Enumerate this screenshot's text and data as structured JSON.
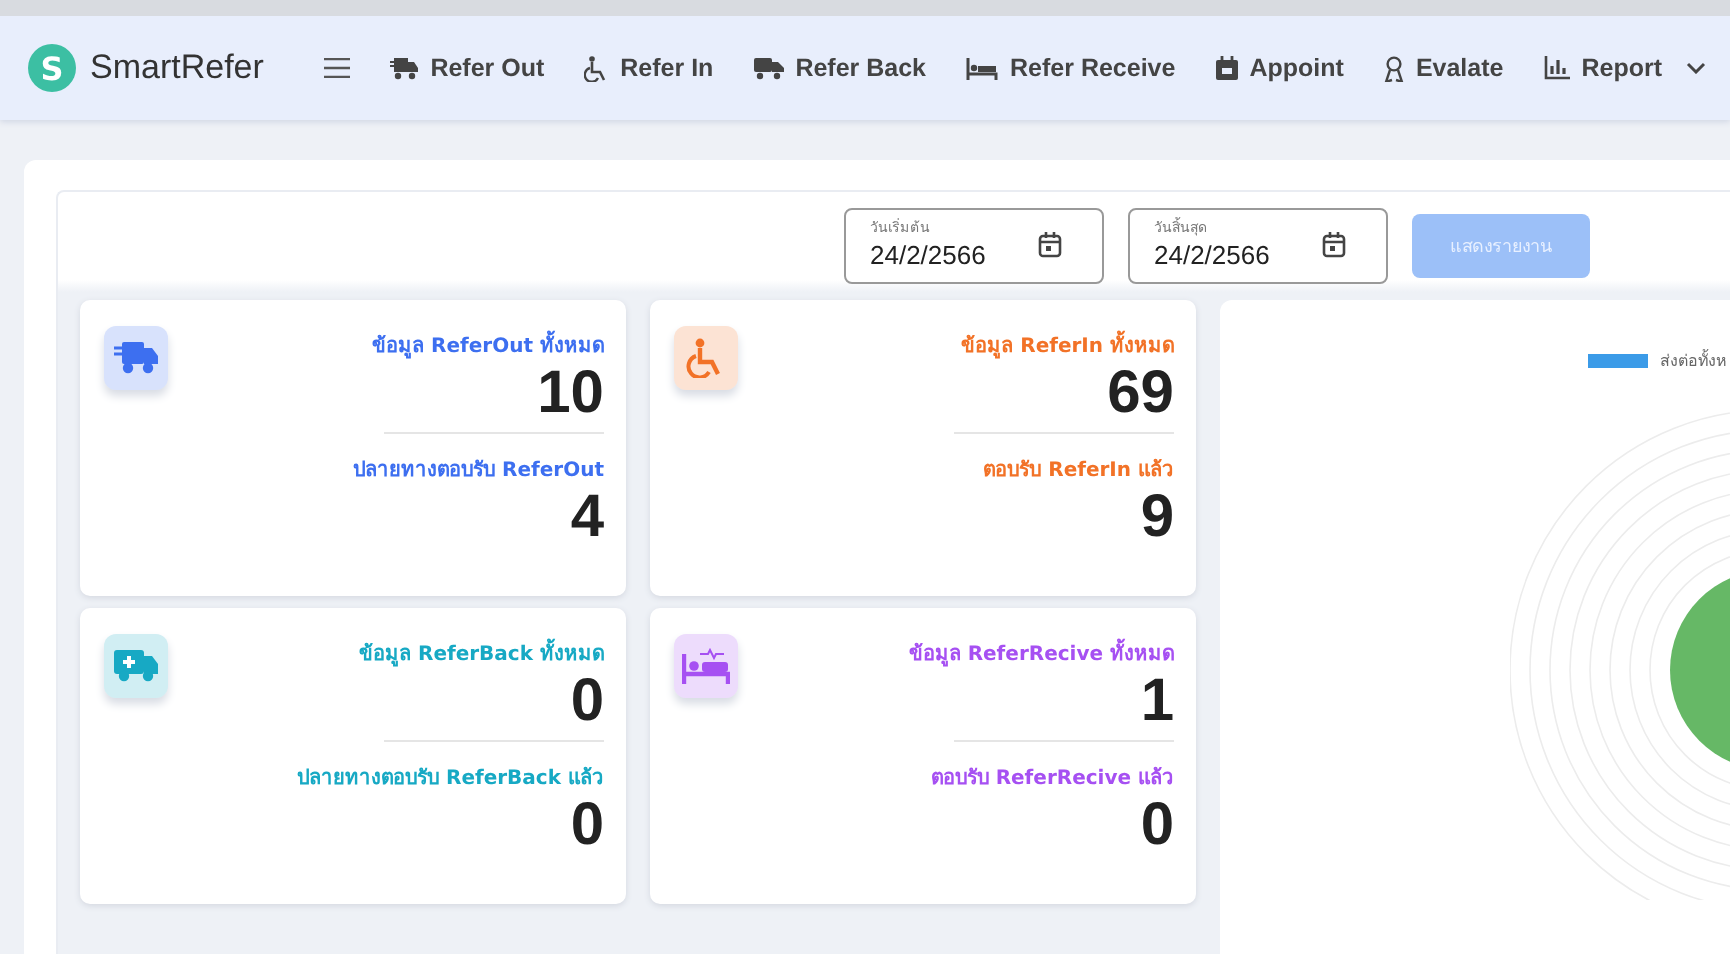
{
  "brand": {
    "name": "SmartRefer",
    "logo_letter": "S"
  },
  "nav": [
    {
      "label": "Refer Out",
      "kind": "truck"
    },
    {
      "label": "Refer In",
      "kind": "wheelchair"
    },
    {
      "label": "Refer Back",
      "kind": "van"
    },
    {
      "label": "Refer Receive",
      "kind": "bed"
    },
    {
      "label": "Appoint",
      "kind": "calendar"
    },
    {
      "label": "Evalate",
      "kind": "ribbon"
    },
    {
      "label": "Report",
      "kind": "chart",
      "dropdown": true
    }
  ],
  "filters": {
    "start": {
      "label": "วันเริ่มต้น",
      "value": "24/2/2566"
    },
    "end": {
      "label": "วันสิ้นสุด",
      "value": "24/2/2566"
    },
    "button": {
      "label": "แสดงรายงาน",
      "disabled": true
    }
  },
  "cards": [
    {
      "kind": "truck",
      "color": "#3d6ff0",
      "total_label": "ข้อมูล ReferOut ทั้งหมด",
      "total": "10",
      "accepted_label": "ปลายทางตอบรับ ReferOut",
      "accepted": "4"
    },
    {
      "kind": "wheelchair",
      "color": "#f27227",
      "total_label": "ข้อมูล ReferIn ทั้งหมด",
      "total": "69",
      "accepted_label": "ตอบรับ ReferIn แล้ว",
      "accepted": "9"
    },
    {
      "kind": "ambulance",
      "color": "#17a9c4",
      "total_label": "ข้อมูล ReferBack ทั้งหมด",
      "total": "0",
      "accepted_label": "ปลายทางตอบรับ ReferBack แล้ว",
      "accepted": "0"
    },
    {
      "kind": "bed",
      "color": "#a650f2",
      "total_label": "ข้อมูล ReferRecive ทั้งหมด",
      "total": "1",
      "accepted_label": "ตอบรับ ReferRecive แล้ว",
      "accepted": "0"
    }
  ],
  "chart": {
    "legend": [
      {
        "label": "ส่งต่อทั้งห",
        "color": "#3b9be8"
      }
    ]
  }
}
